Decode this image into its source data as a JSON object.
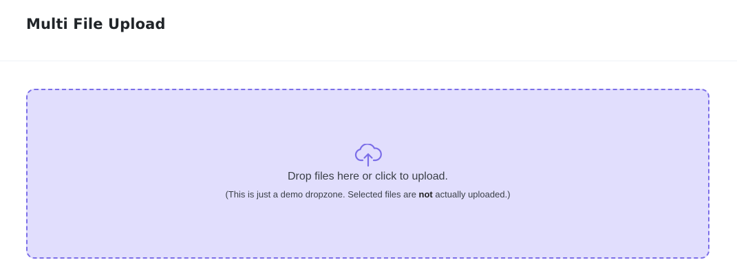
{
  "header": {
    "title": "Multi File Upload"
  },
  "dropzone": {
    "icon": "cloud-upload-icon",
    "accent_color": "#7b6ee8",
    "background_color": "#e1defd",
    "message": "Drop files here or click to upload.",
    "note_before": "(This is just a demo dropzone. Selected files are",
    "note_emphasis": "not",
    "note_after": "actually uploaded.)"
  }
}
